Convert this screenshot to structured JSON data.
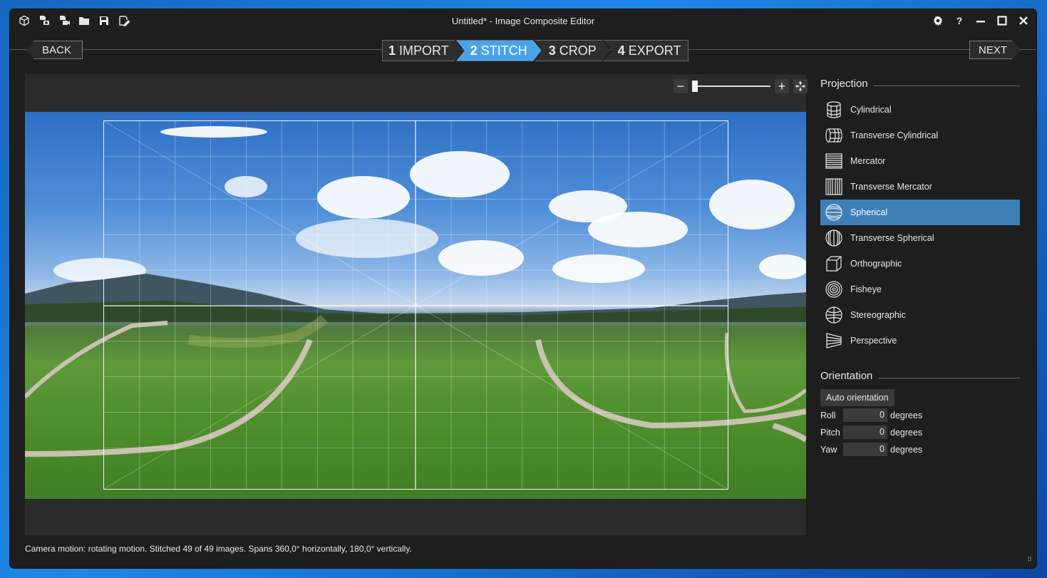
{
  "window": {
    "title": "Untitled* - Image Composite Editor"
  },
  "toolbar": {
    "icons": [
      "new-panorama-icon",
      "new-from-images-icon",
      "new-from-video-icon",
      "open-project-icon",
      "save-project-icon",
      "save-as-icon"
    ]
  },
  "window_controls": {
    "settings": "⚙",
    "help": "?",
    "minimize": "—",
    "maximize": "☐",
    "close": "✕"
  },
  "nav": {
    "back_label": "BACK",
    "next_label": "NEXT"
  },
  "steps": [
    {
      "num": "1",
      "label": "IMPORT",
      "active": false
    },
    {
      "num": "2",
      "label": "STITCH",
      "active": true
    },
    {
      "num": "3",
      "label": "CROP",
      "active": false
    },
    {
      "num": "4",
      "label": "EXPORT",
      "active": false
    }
  ],
  "zoom": {
    "minus": "−",
    "plus": "+",
    "level_fraction": 0.0
  },
  "panel": {
    "projection_heading": "Projection",
    "projections": [
      {
        "label": "Cylindrical",
        "icon": "cylindrical-icon",
        "selected": false
      },
      {
        "label": "Transverse Cylindrical",
        "icon": "transverse-cylindrical-icon",
        "selected": false
      },
      {
        "label": "Mercator",
        "icon": "mercator-icon",
        "selected": false
      },
      {
        "label": "Transverse Mercator",
        "icon": "transverse-mercator-icon",
        "selected": false
      },
      {
        "label": "Spherical",
        "icon": "spherical-icon",
        "selected": true
      },
      {
        "label": "Transverse Spherical",
        "icon": "transverse-spherical-icon",
        "selected": false
      },
      {
        "label": "Orthographic",
        "icon": "orthographic-icon",
        "selected": false
      },
      {
        "label": "Fisheye",
        "icon": "fisheye-icon",
        "selected": false
      },
      {
        "label": "Stereographic",
        "icon": "stereographic-icon",
        "selected": false
      },
      {
        "label": "Perspective",
        "icon": "perspective-icon",
        "selected": false
      }
    ],
    "orientation_heading": "Orientation",
    "auto_orientation_label": "Auto orientation",
    "roll": {
      "label": "Roll",
      "value": "0",
      "unit": "degrees"
    },
    "pitch": {
      "label": "Pitch",
      "value": "0",
      "unit": "degrees"
    },
    "yaw": {
      "label": "Yaw",
      "value": "0",
      "unit": "degrees"
    }
  },
  "status": {
    "text": "Camera motion: rotating motion. Stitched 49 of 49 images. Spans 360,0° horizontally, 180,0° vertically."
  },
  "colors": {
    "accent": "#4aa3ea",
    "selected_row": "#3f7fb8",
    "bg": "#1e1e1e"
  }
}
